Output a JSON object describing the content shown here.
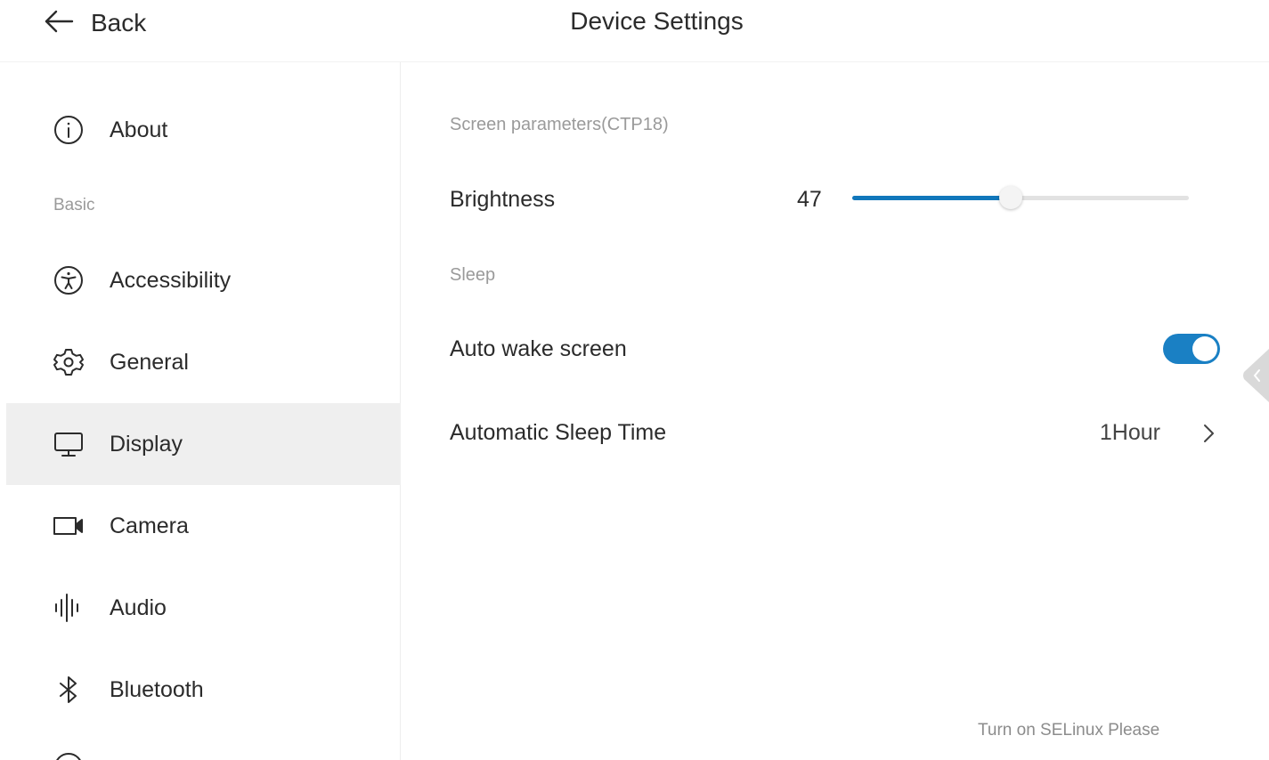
{
  "header": {
    "back_label": "Back",
    "title": "Device Settings"
  },
  "sidebar": {
    "items": [
      {
        "label": "About",
        "icon": "info-icon"
      },
      {
        "label": "Accessibility",
        "icon": "accessibility-icon"
      },
      {
        "label": "General",
        "icon": "gear-icon"
      },
      {
        "label": "Display",
        "icon": "monitor-icon",
        "active": true
      },
      {
        "label": "Camera",
        "icon": "camera-icon"
      },
      {
        "label": "Audio",
        "icon": "audio-wave-icon"
      },
      {
        "label": "Bluetooth",
        "icon": "bluetooth-icon"
      }
    ],
    "section_basic": "Basic"
  },
  "main": {
    "screen_group_label": "Screen parameters(CTP18)",
    "brightness": {
      "label": "Brightness",
      "value": "47",
      "level": 0.47
    },
    "sleep_group_label": "Sleep",
    "auto_wake": {
      "label": "Auto wake screen",
      "on": true
    },
    "auto_sleep": {
      "label": "Automatic Sleep Time",
      "value": "1Hour"
    },
    "footer_note": "Turn on SELinux Please"
  },
  "colors": {
    "accent": "#1a80c4",
    "active_bg": "#efefef",
    "muted_text": "#9a9a9a"
  }
}
